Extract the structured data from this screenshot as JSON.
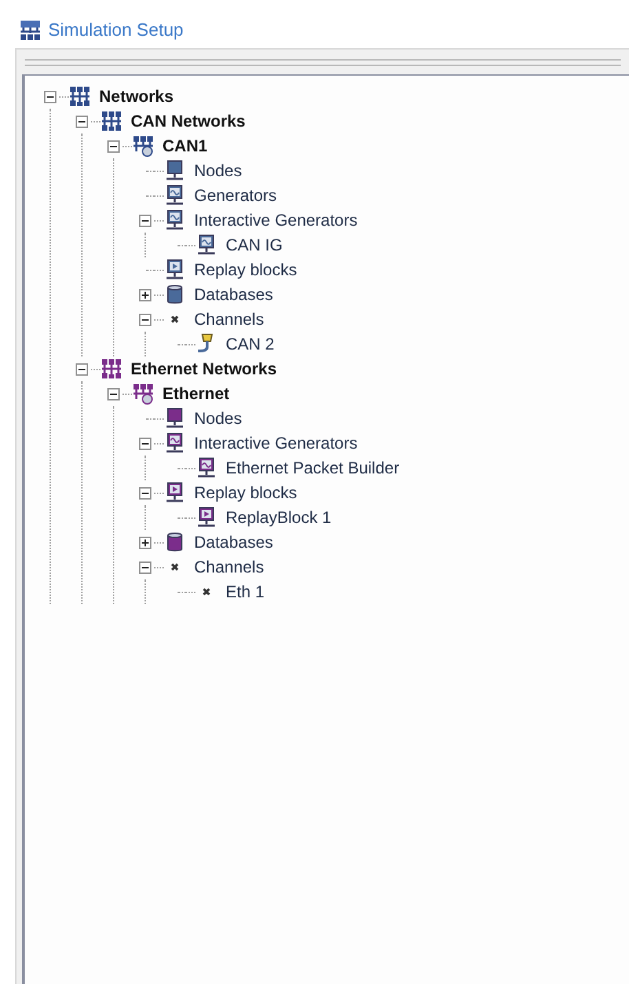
{
  "header": {
    "title": "Simulation Setup"
  },
  "tree": [
    {
      "label": "Networks",
      "bold": true,
      "kind": "network",
      "color": "#2e4a8a",
      "expanded": true,
      "children": [
        {
          "label": "CAN Networks",
          "bold": true,
          "kind": "network",
          "color": "#2e4a8a",
          "expanded": true,
          "children": [
            {
              "label": "CAN1",
              "bold": true,
              "kind": "bus",
              "color": "#2e4a8a",
              "expanded": true,
              "children": [
                {
                  "label": "Nodes",
                  "bold": false,
                  "kind": "node",
                  "color": "#4a6a9a"
                },
                {
                  "label": "Generators",
                  "bold": false,
                  "kind": "generator",
                  "color": "#4a6a9a"
                },
                {
                  "label": "Interactive Generators",
                  "bold": false,
                  "kind": "generator",
                  "color": "#4a6a9a",
                  "expanded": true,
                  "children": [
                    {
                      "label": "CAN IG",
                      "bold": false,
                      "kind": "generator",
                      "color": "#4a6a9a"
                    }
                  ]
                },
                {
                  "label": "Replay blocks",
                  "bold": false,
                  "kind": "replay",
                  "color": "#4a6a9a"
                },
                {
                  "label": "Databases",
                  "bold": false,
                  "kind": "database",
                  "color": "#4a6a9a",
                  "expanded": false
                },
                {
                  "label": "Channels",
                  "bold": false,
                  "kind": "channel",
                  "color": "#333333",
                  "expanded": true,
                  "children": [
                    {
                      "label": "CAN 2",
                      "bold": false,
                      "kind": "connector",
                      "color": "#4a6a9a"
                    }
                  ]
                }
              ]
            }
          ]
        },
        {
          "label": "Ethernet Networks",
          "bold": true,
          "kind": "network",
          "color": "#7b2d8b",
          "expanded": true,
          "children": [
            {
              "label": "Ethernet",
              "bold": true,
              "kind": "bus",
              "color": "#7b2d8b",
              "expanded": true,
              "children": [
                {
                  "label": "Nodes",
                  "bold": false,
                  "kind": "node",
                  "color": "#7b2d8b"
                },
                {
                  "label": "Interactive Generators",
                  "bold": false,
                  "kind": "generator",
                  "color": "#7b2d8b",
                  "expanded": true,
                  "children": [
                    {
                      "label": "Ethernet Packet Builder",
                      "bold": false,
                      "kind": "generator",
                      "color": "#7b2d8b"
                    }
                  ]
                },
                {
                  "label": "Replay blocks",
                  "bold": false,
                  "kind": "replay",
                  "color": "#7b2d8b",
                  "expanded": true,
                  "children": [
                    {
                      "label": "ReplayBlock 1",
                      "bold": false,
                      "kind": "replay",
                      "color": "#7b2d8b"
                    }
                  ]
                },
                {
                  "label": "Databases",
                  "bold": false,
                  "kind": "database",
                  "color": "#7b2d8b",
                  "expanded": false
                },
                {
                  "label": "Channels",
                  "bold": false,
                  "kind": "channel",
                  "color": "#333333",
                  "expanded": true,
                  "children": [
                    {
                      "label": "Eth 1",
                      "bold": false,
                      "kind": "channel",
                      "color": "#333333"
                    }
                  ]
                }
              ]
            }
          ]
        }
      ]
    }
  ]
}
